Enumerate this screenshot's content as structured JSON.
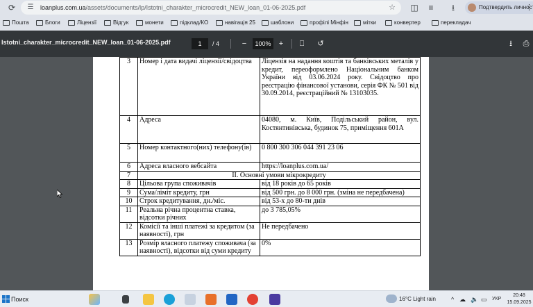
{
  "browser": {
    "url_host": "loanplus.com.ua",
    "url_path": "/assets/documents/lp/Istotni_charakter_microcredit_NEW_loan_01-06-2025.pdf",
    "profile_label": "Подтвердить личность",
    "bookmarks": [
      "Пошта",
      "Блоги",
      "Ліцензії",
      "Відгук",
      "монети",
      "підклад/КО",
      "навігація 25",
      "шаблони",
      "профілі Мінфін",
      "мітки",
      "конвертер",
      "перекладач"
    ]
  },
  "pdf_toolbar": {
    "title": "Istotni_charakter_microcredit_NEW_loan_01-06-2025.pdf",
    "current_page": "1",
    "total_pages": "/ 4",
    "zoom": "100%"
  },
  "table": {
    "rows": [
      {
        "num": "3",
        "label": "Номер і дата видачі ліцензії/свідоцтва",
        "value": "Ліцензія на надання коштів та банківських металів у кредит, переоформлено Національним банком України від 03.06.2024 року. Свідоцтво про реєстрацію фінансової установи, серія ФК № 501 від 30.09.2014, реєстраційний № 13103035."
      },
      {
        "num": "4",
        "label": "Адреса",
        "value": "04080, м. Київ, Подільський район, вул. Костянтинівська, будинок 75, приміщення 601А"
      },
      {
        "num": "5",
        "label": "Номер контактного(них) телефону(ів)",
        "value": "0 800 300 306 044 391 23 06"
      },
      {
        "num": "6",
        "label": "Адреса власного вебсайта",
        "value": "https://loanplus.com.ua/"
      },
      {
        "num": "7",
        "section": "II. Основні умови мікрокредиту"
      },
      {
        "num": "8",
        "label": "Цільова група споживачів",
        "value": "від 18 років до 65 років"
      },
      {
        "num": "9",
        "label": "Сума/ліміт кредиту, грн",
        "value": "від 500 грн. до 8 000 грн. (зміна не передбачена)"
      },
      {
        "num": "10",
        "label": "Строк кредитування, дн./міс.",
        "value": "від 53-х до 80-ти днів"
      },
      {
        "num": "11",
        "label": "Реальна річна процентна ставка, відсотки річних",
        "value": "до 3 785,05%"
      },
      {
        "num": "12",
        "label": "Комісії та інші платежі за кредитом (за наявності), грн",
        "value": "Не передбачено"
      },
      {
        "num": "13",
        "label": "Розмір власного платежу споживача (за наявності), відсотки від суми кредиту",
        "value": "0%"
      }
    ]
  },
  "taskbar": {
    "search_label": "Поиск",
    "weather": "16°C  Light rain",
    "lang": "УКР",
    "time": "20:48",
    "date": "15.09.2025"
  },
  "colors": {
    "pdf_toolbar_bg": "#323639",
    "doc_bg": "#525659",
    "browser_bg": "#dfe3ea"
  }
}
